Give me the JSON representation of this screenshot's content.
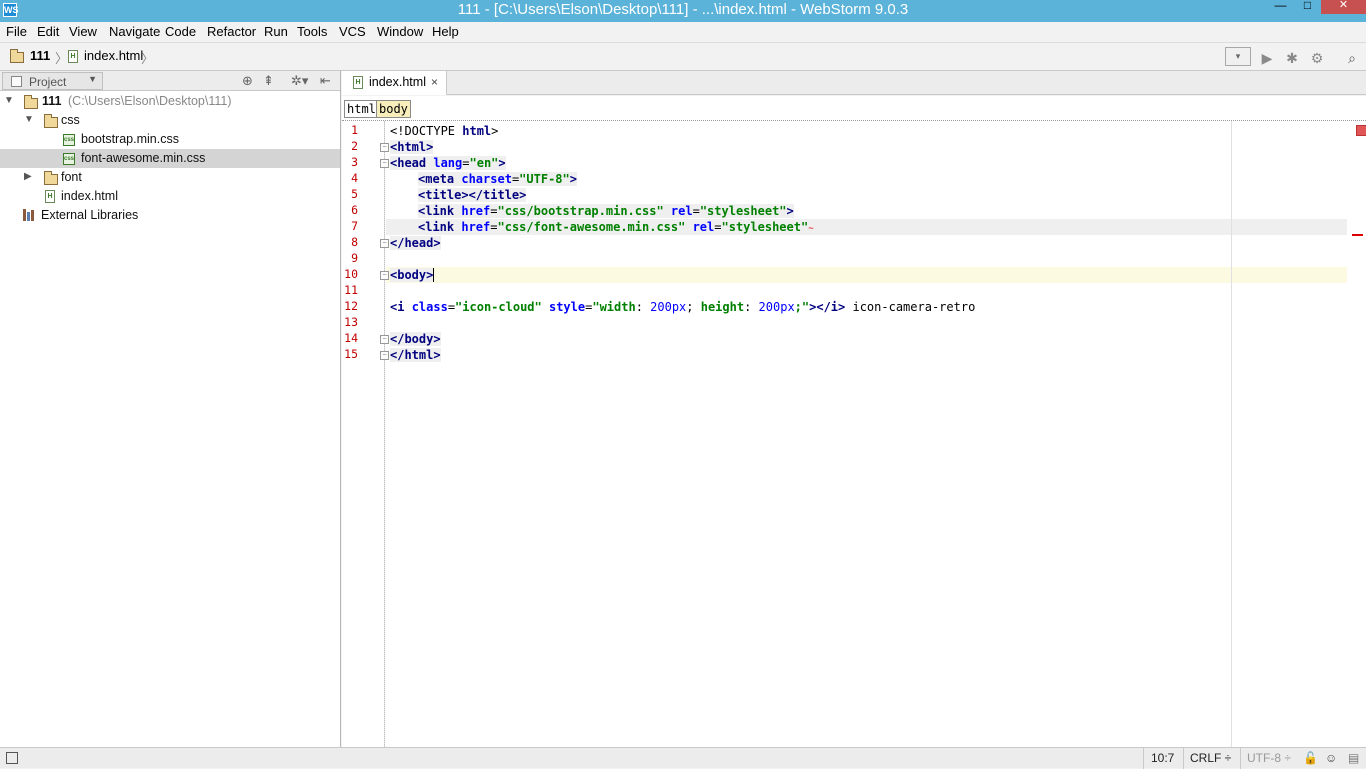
{
  "window": {
    "title": "111 - [C:\\Users\\Elson\\Desktop\\111] - ...\\index.html - WebStorm 9.0.3",
    "app_icon_glyph": "WS",
    "controls": {
      "minimize": "—",
      "maximize": "□",
      "close": "✕"
    }
  },
  "menu": [
    "File",
    "Edit",
    "View",
    "Navigate",
    "Code",
    "Refactor",
    "Run",
    "Tools",
    "VCS",
    "Window",
    "Help"
  ],
  "nav": {
    "crumbs": [
      "111",
      "index.html"
    ],
    "run_combo_glyph": "▾",
    "toolbar_icons": [
      "run-icon",
      "debug-icon",
      "coverage-icon",
      "search-icon"
    ],
    "toolbar_glyphs": [
      "▶",
      "✱",
      "⚙",
      "⌕"
    ]
  },
  "project": {
    "selector_label": "Project",
    "header_icons": [
      "target-icon",
      "collapse-icon",
      "settings-icon",
      "hide-icon"
    ],
    "header_glyphs": [
      "⊕",
      "⇞",
      "✲▾",
      "⇤"
    ],
    "tree": [
      {
        "label": "111",
        "hint": "(C:\\Users\\Elson\\Desktop\\111)",
        "kind": "folder",
        "expanded": true
      },
      {
        "label": "css",
        "kind": "folder",
        "expanded": true
      },
      {
        "label": "bootstrap.min.css",
        "kind": "css"
      },
      {
        "label": "font-awesome.min.css",
        "kind": "css",
        "selected": true
      },
      {
        "label": "font",
        "kind": "folder",
        "expanded": false
      },
      {
        "label": "index.html",
        "kind": "html"
      },
      {
        "label": "External Libraries",
        "kind": "library"
      }
    ]
  },
  "editor": {
    "tab": {
      "label": "index.html",
      "close": "×"
    },
    "tag_path": [
      "html",
      "body"
    ],
    "line_numbers": [
      "1",
      "2",
      "3",
      "4",
      "5",
      "6",
      "7",
      "8",
      "9",
      "10",
      "11",
      "12",
      "13",
      "14",
      "15"
    ],
    "code": {
      "l1": {
        "a": "<!DOCTYPE ",
        "b": "html",
        "c": ">"
      },
      "l2": {
        "a": "<html>"
      },
      "l3": {
        "a": "<head ",
        "b": "lang",
        "c": "=",
        "d": "\"en\"",
        "e": ">"
      },
      "l4": {
        "a": "<meta ",
        "b": "charset",
        "c": "=",
        "d": "\"UTF-8\"",
        "e": ">"
      },
      "l5": {
        "a": "<title></title>"
      },
      "l6": {
        "a": "<link ",
        "b": "href",
        "c": "=",
        "d": "\"css/bootstrap.min.css\"",
        "e": " ",
        "f": "rel",
        "g": "=",
        "h": "\"stylesheet\"",
        "i": ">"
      },
      "l7": {
        "a": "<link ",
        "b": "href",
        "c": "=",
        "d": "\"css/font-awesome.min.css\"",
        "e": " ",
        "f": "rel",
        "g": "=",
        "h": "\"stylesheet\"",
        "i": ">"
      },
      "l8": {
        "a": "</head>"
      },
      "l10": {
        "a": "<body>"
      },
      "l12": {
        "a": "<i ",
        "b": "class",
        "c": "=",
        "d": "\"icon-cloud\"",
        "e": " ",
        "f": "style",
        "g": "=",
        "h": "\"width",
        "i": ": ",
        "j": "200px",
        "k": "; ",
        "l": "height",
        "m": ": ",
        "n": "200px",
        "o": ";\"",
        "p": "></i>",
        "q": " icon-camera-retro"
      },
      "l14": {
        "a": "</body>"
      },
      "l15": {
        "a": "</html>"
      }
    },
    "squiggle_glyph": "~"
  },
  "status": {
    "caret_pos": "10:7",
    "line_sep": "CRLF ÷",
    "encoding": "UTF-8 ÷",
    "lock_icon": "lock-icon",
    "inspector_icon": "inspector-icon"
  },
  "colors": {
    "titlebar": "#5cb3d9",
    "close_button": "#c75050",
    "tag": "#000080",
    "attribute": "#0000ff",
    "string": "#008000",
    "line_number": "#c00000",
    "current_line": "#fcfae1",
    "error": "#e05555"
  }
}
